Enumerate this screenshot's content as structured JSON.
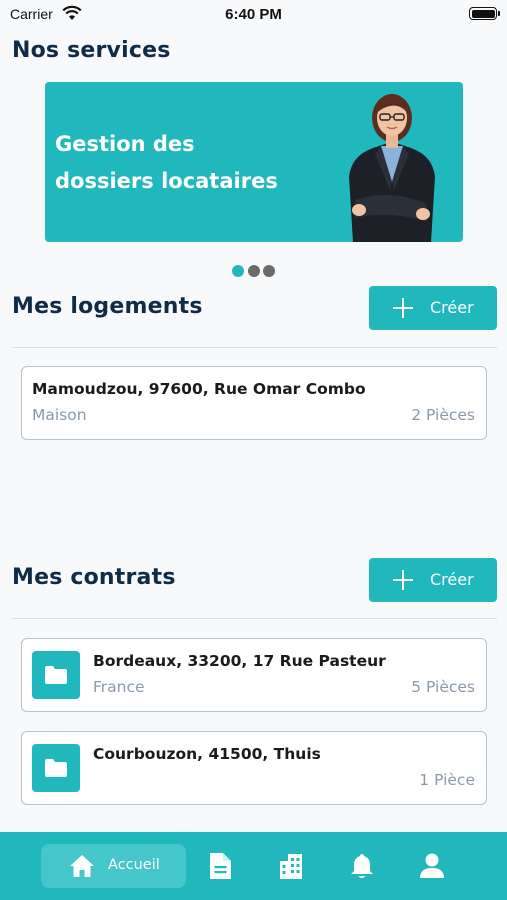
{
  "status_bar": {
    "carrier": "Carrier",
    "time": "6:40 PM"
  },
  "services": {
    "title": "Nos services",
    "banner_line1": "Gestion des",
    "banner_line2": "dossiers locataires"
  },
  "logements": {
    "title": "Mes logements",
    "create_label": "Créer",
    "items": [
      {
        "address": "Mamoudzou, 97600, Rue Omar Combo",
        "type": "Maison",
        "rooms": "2 Pièces"
      }
    ]
  },
  "contrats": {
    "title": "Mes contrats",
    "create_label": "Créer",
    "items": [
      {
        "address": "Bordeaux, 33200, 17 Rue Pasteur",
        "country": "France",
        "rooms": "5 Pièces"
      },
      {
        "address": "Courbouzon, 41500, Thuis",
        "country": "",
        "rooms": "1 Pièce"
      }
    ]
  },
  "bottom_nav": {
    "home_label": "Accueil"
  },
  "colors": {
    "accent": "#21b8bd",
    "title": "#0f2b45",
    "muted": "#8a9aab"
  }
}
